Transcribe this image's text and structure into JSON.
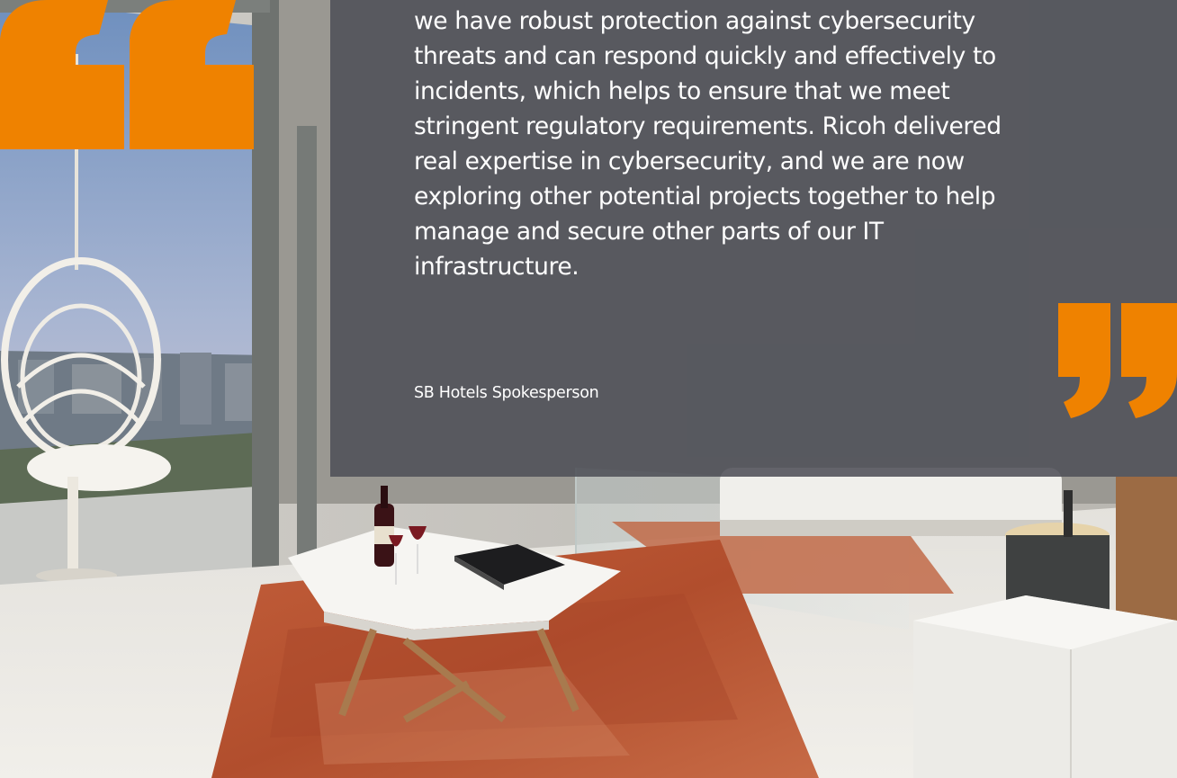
{
  "quote": {
    "text": "we have robust protection against cybersecurity\nthreats and can respond quickly and effectively to\nincidents, which helps to ensure that we meet\nstringent regulatory requirements. Ricoh delivered\nreal expertise in cybersecurity, and we are now\nexploring other potential projects together to help\nmanage and secure other parts of our IT\ninfrastructure.",
    "author": "SB Hotels Spokesperson"
  },
  "icons": {
    "open_quote": "open-quote-icon",
    "close_quote": "close-quote-icon"
  },
  "colors": {
    "accent": "#EF8200",
    "panel": "#4E5058",
    "text": "#FFFFFF"
  }
}
